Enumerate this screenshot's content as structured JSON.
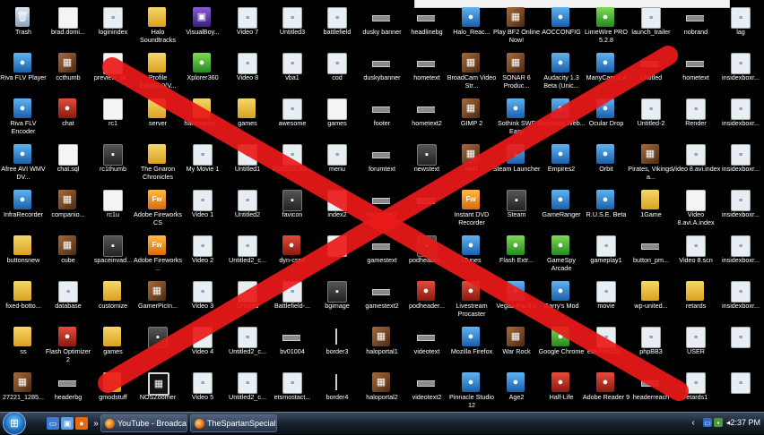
{
  "desktop": {
    "grid": [
      [
        "Trash",
        "brad.domi...",
        "loginindex",
        "Halo Soundtracks",
        "VisualBoy...",
        "Video 7",
        "Untitled3",
        "battlefield",
        "dusky banner",
        "headlinebg",
        "Halo_Reac...",
        "Play BF2 Online Now!",
        "AOCCONFIG",
        "LimeWire PRO 5.2.8",
        "launch_trailer",
        "nobrand",
        "lag"
      ],
      [
        "Riva FLV Player",
        "ccthumb",
        "preview_bk...",
        "Profile Editor2.0(V...",
        "Xplorer360",
        "Video 8",
        "vba1",
        "cod",
        "duskybanner",
        "hometext",
        "BroadCam Video Str...",
        "SONAR 6 Produc...",
        "Audacity 1.3 Beta (Unic...",
        "ManyCam 2.4",
        "Untitled",
        "hometext",
        "insidexboxr..."
      ],
      [
        "Riva FLV Encoder",
        "chat",
        "rc1",
        "server",
        "haloreachs...",
        "games",
        "awesome",
        "games",
        "footer",
        "hometext2",
        "GIMP 2",
        "Sothink SWF Easy",
        "BlueVoda Web...",
        "Ocular Drop",
        "Untitled-2",
        "Render",
        "insidexboxr..."
      ],
      [
        "Afree AVI WMV DV...",
        "chat.sql",
        "rc1thumb",
        "The Gnaron Chronicles",
        "My Movie 1",
        "Untitled1",
        "E00000C85...",
        "menu",
        "forumtext",
        "newstext",
        "HxD",
        "Steam Launcher",
        "Empires2",
        "Orbit",
        "Pirates, Vikings, a...",
        "Video 8.avi.index",
        "insidexboxr..."
      ],
      [
        "InfraRecorder",
        "companio...",
        "rc1u",
        "Adobe Fireworks CS",
        "Video 1",
        "Untitled2",
        "favicon",
        "index2",
        "forumtext2",
        "",
        "Instant DVD Recorder",
        "Steam",
        "GameRanger",
        "R.U.S.E. Beta",
        "1Game",
        "Video 8.avi.A.index",
        "insidexboxr..."
      ],
      [
        "buttonsnew",
        "cube",
        "spaceinvad...",
        "Adobe Fireworks ...",
        "Video 2",
        "Untitled2_c...",
        "dyn-csp6",
        "",
        "gamestext",
        "podheader...",
        "iTunes",
        "Flash Extr...",
        "GameSpy Arcade",
        "gameplay1",
        "button_pm...",
        "Video 8.scn",
        "insidexboxr..."
      ],
      [
        "fixed-botto...",
        "database",
        "customize",
        "GamerPicIn...",
        "Video 3",
        "Untitled",
        "Battlefield-...",
        "bgimage",
        "gamestext2",
        "podheader...",
        "Livestream Procaster",
        "Vegas Pro 8.0",
        "Garry's Mod",
        "movie",
        "wp-united...",
        "retards",
        "insidexboxr..."
      ],
      [
        "ss",
        "Flash Optimizer 2",
        "games",
        "",
        "Video 4",
        "Untitled2_c...",
        "bv01004",
        "border3",
        "haloportal1",
        "videotext",
        "Mozilla Firefox",
        "War Rock",
        "Google Chrome",
        "e9947d033...",
        "phpBB3",
        "USER",
        ""
      ],
      [
        "27221_1285...",
        "headerbg",
        "gmodstuff",
        "NOSZoomer",
        "Video 5",
        "Untitled2_c...",
        "etsmostact...",
        "border4",
        "haloportal2",
        "videotext2",
        "Pinnacle Studio 12",
        "Age2",
        "Half-Life",
        "Adobe Reader 9",
        "headerreach",
        "retards1",
        ""
      ]
    ],
    "icon_types": [
      [
        "trash",
        "file",
        "doc",
        "folder",
        "purple",
        "doc",
        "doc",
        "doc",
        "bar",
        "bar",
        "blue",
        "img",
        "blue",
        "green",
        "doc",
        "bar",
        "doc"
      ],
      [
        "blue",
        "img",
        "file",
        "folder",
        "green",
        "doc",
        "doc",
        "doc",
        "bar",
        "bar",
        "img",
        "img",
        "blue",
        "blue",
        "bar",
        "bar",
        "doc"
      ],
      [
        "blue",
        "red",
        "file",
        "folder",
        "folder",
        "folder",
        "doc",
        "file",
        "bar",
        "bar",
        "img",
        "blue",
        "blue",
        "blue",
        "doc",
        "doc",
        "doc"
      ],
      [
        "blue",
        "file",
        "dark",
        "folder",
        "doc",
        "doc",
        "doc",
        "doc",
        "bar",
        "dark",
        "img",
        "blue",
        "blue",
        "blue",
        "img",
        "doc",
        "doc"
      ],
      [
        "blue",
        "img",
        "file",
        "orange",
        "doc",
        "doc",
        "dark",
        "doc",
        "bar",
        "bar",
        "orange",
        "dark",
        "blue",
        "blue",
        "folder",
        "file",
        "doc"
      ],
      [
        "folder",
        "img",
        "dark",
        "orange",
        "doc",
        "doc",
        "red",
        "file",
        "bar",
        "dark",
        "blue",
        "green",
        "green",
        "doc",
        "bar",
        "doc",
        "doc"
      ],
      [
        "folder",
        "doc",
        "folder",
        "img",
        "doc",
        "doc",
        "doc",
        "dark",
        "bar",
        "red",
        "red",
        "blue",
        "blue",
        "doc",
        "folder",
        "folder",
        "doc"
      ],
      [
        "folder",
        "red",
        "folder",
        "dark",
        "doc",
        "doc",
        "bar",
        "line",
        "img",
        "bar",
        "blue",
        "img",
        "green",
        "doc",
        "doc",
        "doc",
        "doc"
      ],
      [
        "img",
        "bar",
        "folder",
        "film",
        "doc",
        "doc",
        "doc",
        "line",
        "img",
        "bar",
        "blue",
        "blue",
        "red",
        "red",
        "bar",
        "doc",
        "doc"
      ]
    ],
    "icon_glyphs": {
      "trash": "🗑",
      "folder": "",
      "file": "",
      "doc": "≡",
      "blue": "●",
      "green": "●",
      "purple": "▣",
      "dark": "▪",
      "bar": "",
      "img": "▦",
      "orange": "Fw",
      "red": "●",
      "vid": "▶",
      "film": "▦",
      "line": ""
    }
  },
  "taskbar": {
    "start_glyph": "⊞",
    "quicklaunch": [
      {
        "name": "show-desktop-icon",
        "glyph": "▭",
        "color": "#3a7ad8"
      },
      {
        "name": "switch-windows-icon",
        "glyph": "▣",
        "color": "#5aa0e8"
      },
      {
        "name": "firefox-quicklaunch-icon",
        "glyph": "●",
        "color": "#e46a0c"
      }
    ],
    "more_glyph": "»",
    "buttons": [
      {
        "label": "YouTube - Broadcas..."
      },
      {
        "label": "TheSpartanSpecialO..."
      }
    ],
    "tray_left_glyph": "‹",
    "clock": "2:37 PM"
  }
}
